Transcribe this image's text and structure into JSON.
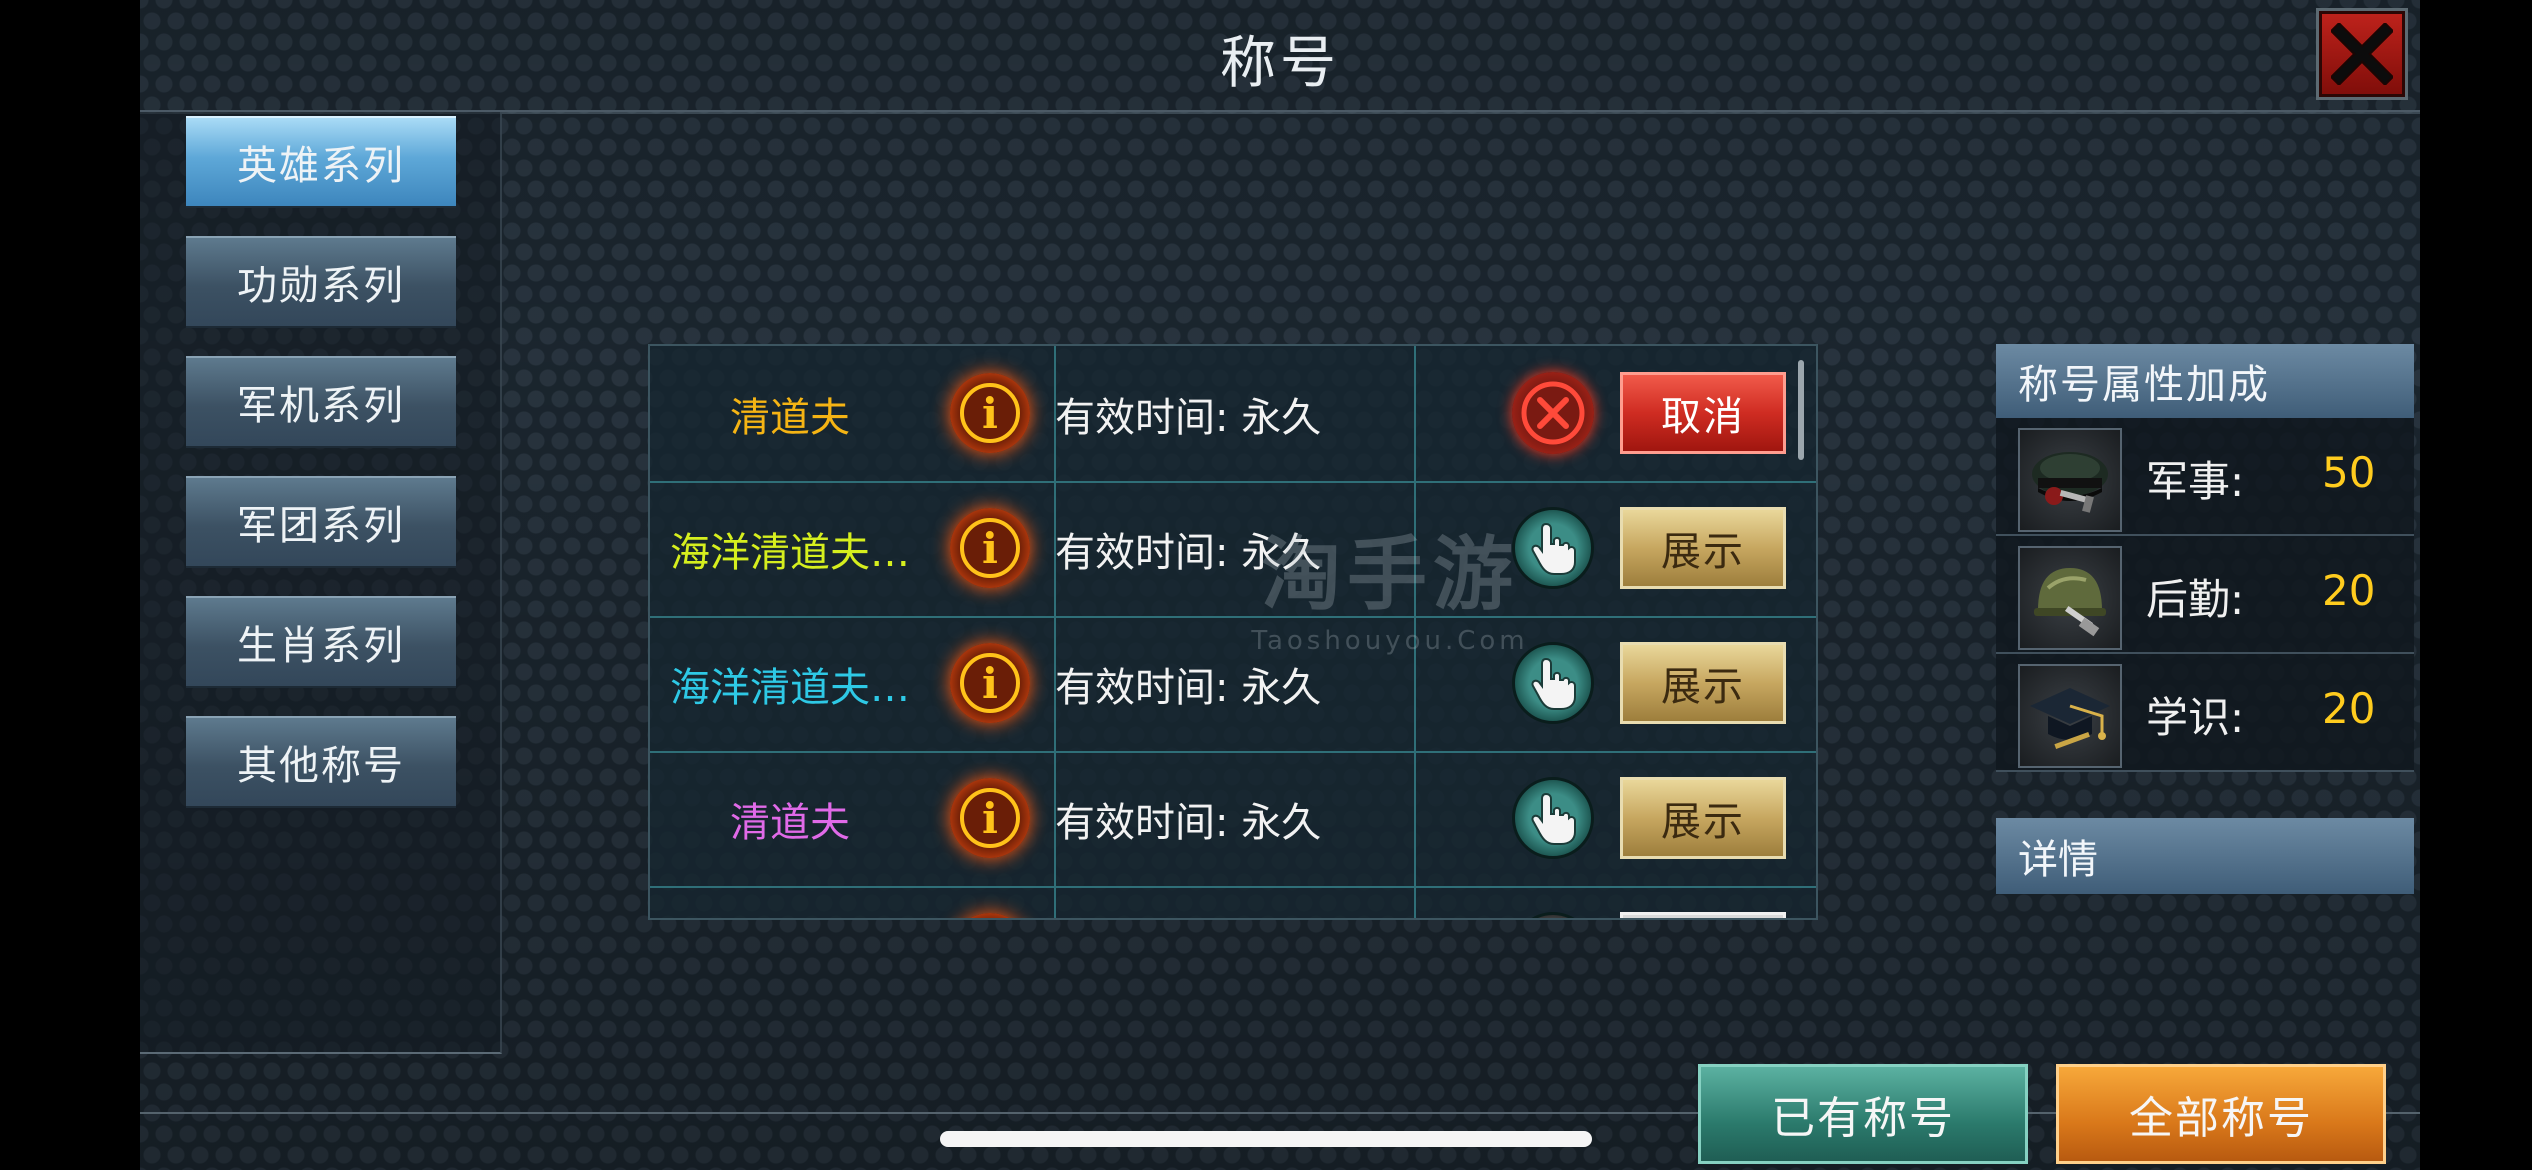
{
  "title": "称号",
  "sidebar": {
    "items": [
      {
        "label": "英雄系列",
        "active": true
      },
      {
        "label": "功勋系列",
        "active": false
      },
      {
        "label": "军机系列",
        "active": false
      },
      {
        "label": "军团系列",
        "active": false
      },
      {
        "label": "生肖系列",
        "active": false
      },
      {
        "label": "其他称号",
        "active": false
      }
    ]
  },
  "list": {
    "rows": [
      {
        "name": "清道夫",
        "name_color": "#f5b414",
        "time": "有效时间: 永久",
        "action": "取消",
        "action_type": "cancel"
      },
      {
        "name": "海洋清道夫…",
        "name_color": "#d6ef1e",
        "time": "有效时间: 永久",
        "action": "展示",
        "action_type": "show"
      },
      {
        "name": "海洋清道夫…",
        "name_color": "#2ec9e6",
        "time": "有效时间: 永久",
        "action": "展示",
        "action_type": "show"
      },
      {
        "name": "清道夫",
        "name_color": "#e06ae8",
        "time": "有效时间: 永久",
        "action": "展示",
        "action_type": "show"
      }
    ]
  },
  "attributes": {
    "header": "称号属性加成",
    "items": [
      {
        "label": "军事:",
        "value": "50",
        "icon": "officer-cap-icon"
      },
      {
        "label": "后勤:",
        "value": "20",
        "icon": "helmet-icon"
      },
      {
        "label": "学识:",
        "value": "20",
        "icon": "graduation-cap-icon"
      }
    ]
  },
  "detail": {
    "header": "详情"
  },
  "bottom": {
    "owned_label": "已有称号",
    "all_label": "全部称号"
  },
  "watermark": {
    "main": "淘手游",
    "sub": "Taoshouyou.Com"
  }
}
